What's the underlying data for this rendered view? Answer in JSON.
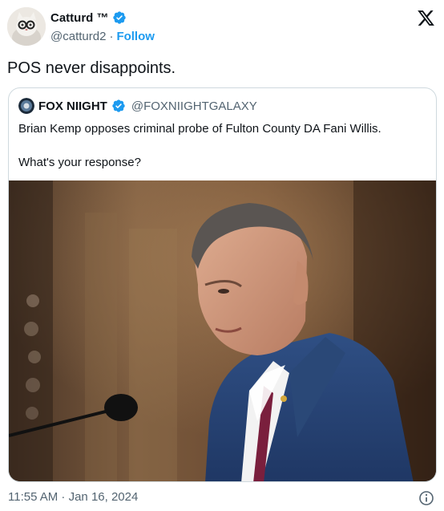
{
  "author": {
    "name": "Catturd ™",
    "handle": "@catturd2",
    "separator": "·",
    "follow_label": "Follow"
  },
  "tweet": {
    "text": "POS never disappoints."
  },
  "quoted": {
    "name": "FOX NIIGHT",
    "handle": "@FOXNIIGHTGALAXY",
    "line1": "Brian Kemp opposes criminal probe of Fulton County DA Fani Willis.",
    "line2": "What's your response?"
  },
  "footer": {
    "timestamp": "11:55 AM · Jan 16, 2024"
  },
  "colors": {
    "verified_blue": "#1d9bf0",
    "secondary_text": "#536471",
    "border": "#cfd9de"
  },
  "icons": {
    "verified": "verified-badge-icon",
    "logo": "x-logo-icon",
    "info": "info-icon"
  }
}
